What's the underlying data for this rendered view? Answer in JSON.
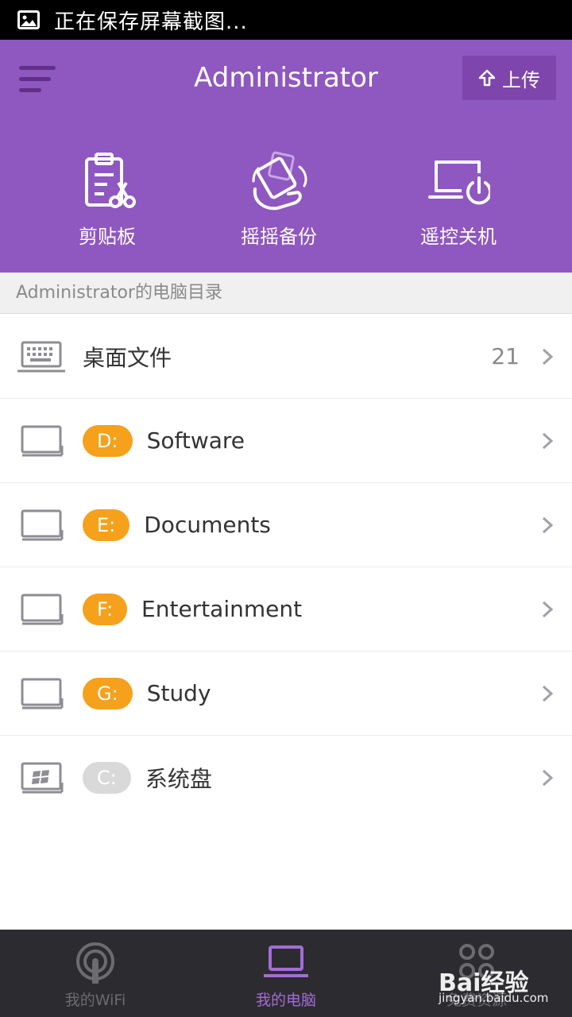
{
  "status_bar": {
    "text": "正在保存屏幕截图..."
  },
  "header": {
    "title": "Administrator",
    "upload_label": "上传",
    "actions": [
      {
        "label": "剪贴板",
        "icon": "clipboard-scissors-icon"
      },
      {
        "label": "摇摇备份",
        "icon": "shake-backup-icon"
      },
      {
        "label": "遥控关机",
        "icon": "remote-shutdown-icon"
      }
    ]
  },
  "section": {
    "title": "Administrator的电脑目录"
  },
  "list": [
    {
      "label": "桌面文件",
      "count": "21",
      "icon": "keyboard-laptop-icon"
    },
    {
      "drive": "D:",
      "label": "Software",
      "badge_color": "#f5a11c"
    },
    {
      "drive": "E:",
      "label": "Documents",
      "badge_color": "#f5a11c"
    },
    {
      "drive": "F:",
      "label": "Entertainment",
      "badge_color": "#f5a11c"
    },
    {
      "drive": "G:",
      "label": "Study",
      "badge_color": "#f5a11c"
    },
    {
      "drive": "C:",
      "label": "系统盘",
      "badge_color": "#d9d9d9",
      "icon": "windows-drive-icon"
    }
  ],
  "bottom_nav": [
    {
      "label": "我的WiFi",
      "icon": "wifi-antenna-icon",
      "active": false
    },
    {
      "label": "我的电脑",
      "icon": "laptop-icon",
      "active": true
    },
    {
      "label": "免费资源",
      "icon": "resources-icon",
      "active": false
    }
  ],
  "watermark": {
    "logo": "Bai经验",
    "url": "jingyan.baidu.com"
  },
  "colors": {
    "header": "#8f57c0",
    "accent_active": "#a36cd6",
    "drive_badge": "#f5a11c",
    "system_badge": "#d9d9d9"
  }
}
